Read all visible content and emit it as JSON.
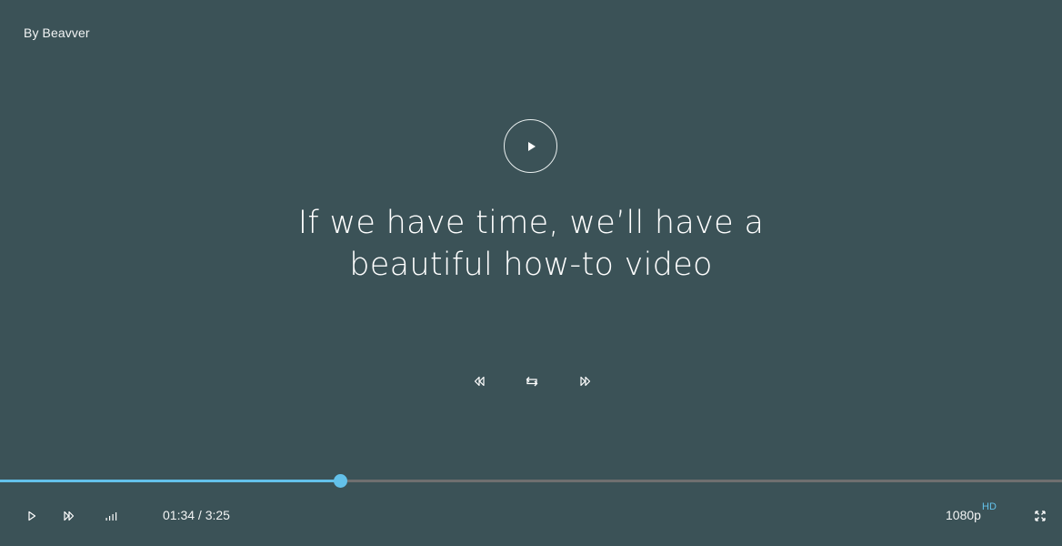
{
  "credit": "By Beavver",
  "title": {
    "line1": "If we have time, we’ll have a",
    "line2": "beautiful how-to video"
  },
  "colors": {
    "background": "#3b5257",
    "accent": "#63c1ea",
    "track": "#6f6f6f",
    "text": "#ffffff"
  },
  "icons": {
    "big_play": "play-icon",
    "rewind": "rewind-icon",
    "loop": "loop-icon",
    "fast_forward": "fast-forward-icon",
    "play": "play-icon",
    "next": "fast-forward-icon",
    "volume": "volume-bars-icon",
    "fullscreen": "fullscreen-icon"
  },
  "playback": {
    "current_time": "01:34",
    "separator": " / ",
    "duration": "3:25",
    "progress_fraction": 0.32
  },
  "quality": {
    "resolution": "1080p",
    "badge": "HD"
  }
}
